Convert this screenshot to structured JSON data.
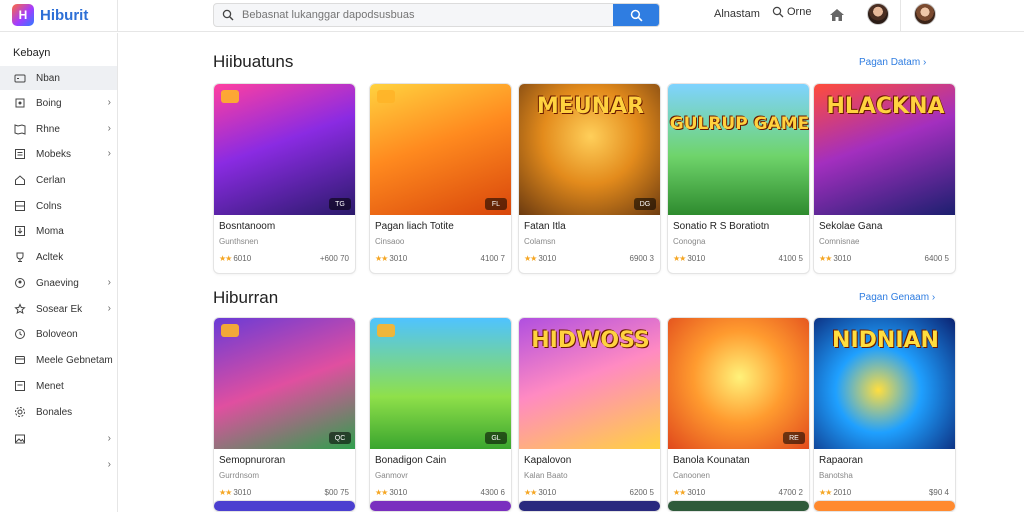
{
  "app": {
    "name": "Hiburit",
    "logo_glyph": "H"
  },
  "search": {
    "placeholder": "Bebasnat lukanggar dapodsusbuas"
  },
  "header": {
    "link_1": "Alnastam",
    "link_2": "Orne"
  },
  "sidebar": {
    "title": "Kebayn",
    "items": [
      {
        "label": "Nban",
        "icon": "game-controller-icon"
      },
      {
        "label": "Boing",
        "icon": "puzzle-icon"
      },
      {
        "label": "Rhne",
        "icon": "map-icon"
      },
      {
        "label": "Mobeks",
        "icon": "list-icon"
      },
      {
        "label": "Cerlan",
        "icon": "home-icon"
      },
      {
        "label": "Colns",
        "icon": "grid-icon"
      },
      {
        "label": "Moma",
        "icon": "download-icon"
      },
      {
        "label": "Acltek",
        "icon": "trophy-icon"
      },
      {
        "label": "Gnaeving",
        "icon": "users-icon"
      },
      {
        "label": "Sosear Ek",
        "icon": "star-icon"
      },
      {
        "label": "Boloveon",
        "icon": "clock-icon"
      },
      {
        "label": "Meele Gebnetam",
        "icon": "card-icon"
      },
      {
        "label": "Menet",
        "icon": "document-icon"
      },
      {
        "label": "Bonales",
        "icon": "gear-icon"
      },
      {
        "label": "",
        "icon": "image-icon"
      },
      {
        "label": "",
        "icon": "more-icon"
      }
    ]
  },
  "sections": [
    {
      "title": "Hiibuatuns",
      "see_all": "Pagan Datam",
      "cards": [
        {
          "title": "Bosntanoom",
          "sub": "Gunthsnen",
          "rating": "6010",
          "count": "+600 70",
          "art_text": "",
          "badge": "TG"
        },
        {
          "title": "Pagan liach Totite",
          "sub": "Cinsaoo",
          "rating": "3010",
          "count": "4100 7",
          "art_text": "",
          "badge": "FL"
        },
        {
          "title": "Fatan Itla",
          "sub": "Colamsn",
          "rating": "3010",
          "count": "6900 3",
          "art_text": "MEUNAR",
          "badge": "DG"
        },
        {
          "title": "Sonatio R S Boratiotn",
          "sub": "Conogna",
          "rating": "3010",
          "count": "4100 5",
          "art_text": "GULRUP GAME",
          "badge": ""
        },
        {
          "title": "Sekolae Gana",
          "sub": "Comnisnae",
          "rating": "3010",
          "count": "6400 5",
          "art_text": "HLACKNA",
          "badge": ""
        }
      ]
    },
    {
      "title": "Hiburran",
      "see_all": "Pagan Genaam",
      "cards": [
        {
          "title": "Semopnuroran",
          "sub": "Gurrdnsom",
          "rating": "3010",
          "count": "$00 75",
          "art_text": "",
          "badge": "QC"
        },
        {
          "title": "Bonadigon Cain",
          "sub": "Ganmovr",
          "rating": "3010",
          "count": "4300 6",
          "art_text": "",
          "badge": "GL"
        },
        {
          "title": "Kapalovon",
          "sub": "Kalan Baato",
          "rating": "3010",
          "count": "6200 5",
          "art_text": "HIDWOSS",
          "badge": ""
        },
        {
          "title": "Banola Kounatan",
          "sub": "Canoonen",
          "rating": "3010",
          "count": "4700 2",
          "art_text": "",
          "badge": "RE"
        },
        {
          "title": "Rapaoran",
          "sub": "Banotsha",
          "rating": "2010",
          "count": "$90 4",
          "art_text": "NIDNIAN",
          "badge": ""
        }
      ]
    }
  ]
}
